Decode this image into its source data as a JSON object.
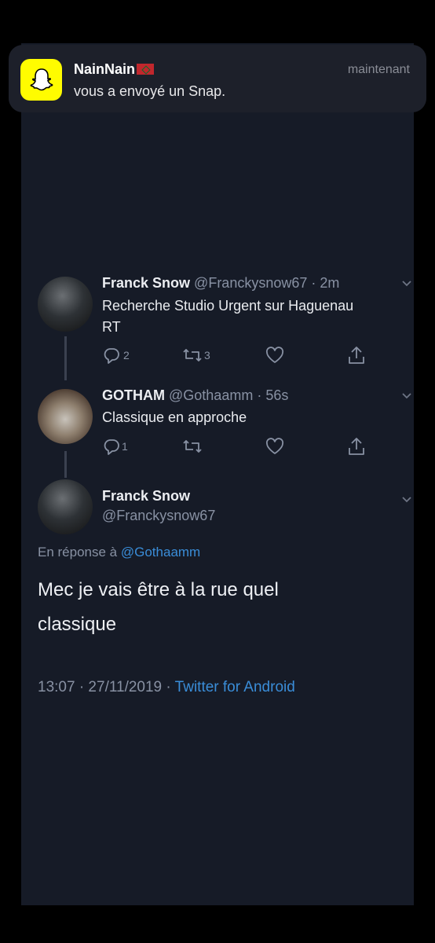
{
  "notification": {
    "app_icon": "snapchat-ghost-icon",
    "sender": "NainNain",
    "flag_icon": "morocco-flag-icon",
    "message": "vous a envoyé un Snap.",
    "time": "maintenant"
  },
  "tweets": [
    {
      "name": "Franck Snow",
      "handle_time": "@Franckysnow67 · 2m",
      "text_lines": [
        "Recherche Studio Urgent sur Haguenau",
        "RT"
      ],
      "reply_count": "2",
      "retweet_count": "3",
      "like_count": ""
    },
    {
      "name": "GOTHAM",
      "handle_time": "@Gothaamm · 56s",
      "text_lines": [
        "Classique en approche"
      ],
      "reply_count": "1",
      "retweet_count": "",
      "like_count": ""
    }
  ],
  "main_tweet": {
    "name": "Franck Snow",
    "handle": "@Franckysnow67",
    "reply_prefix": "En réponse à",
    "reply_handle": "@Gothaamm",
    "text_lines": [
      "Mec je vais être à la rue quel",
      "classique"
    ],
    "timestamp": "13:07 · 27/11/2019 ·",
    "source": "Twitter for Android"
  },
  "colors": {
    "background": "#161b27",
    "accent": "#3a8dd8",
    "snapchat_yellow": "#fffc00"
  }
}
